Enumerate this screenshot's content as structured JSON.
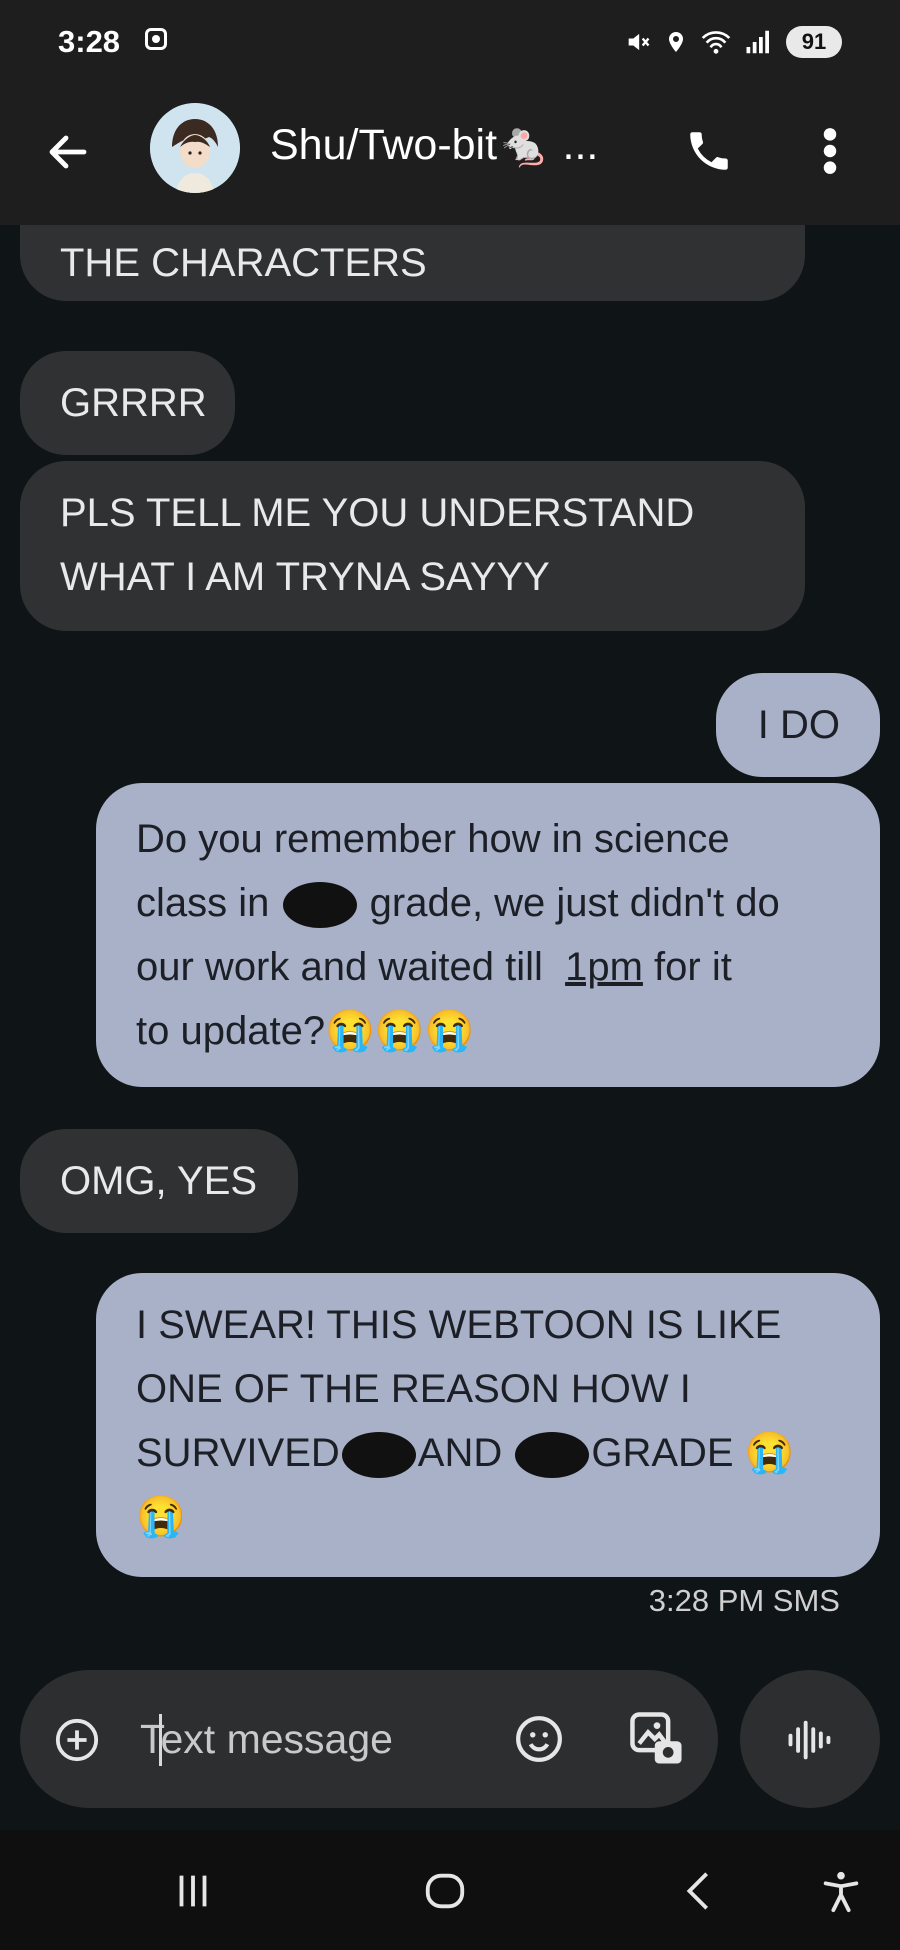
{
  "status_bar": {
    "time": "3:28",
    "battery": "91"
  },
  "header": {
    "contact_name": "Shu/Two-bit🐁 ..."
  },
  "messages": [
    {
      "dir": "in",
      "text": "PEOPLE ARE WEIRD ABT THE CHARACTERS"
    },
    {
      "dir": "in",
      "text": "GRRRR"
    },
    {
      "dir": "in",
      "lines": [
        "PLS TELL ME YOU UNDERSTAND",
        "WHAT I AM TRYNA SAYYY"
      ]
    },
    {
      "dir": "out",
      "text": "I DO"
    },
    {
      "dir": "out",
      "parts": [
        "Do you remember how in science",
        "class in",
        "grade, we just didn't do",
        "our work and waited till",
        "1pm",
        "for it",
        "to update?"
      ],
      "emoji": "😭😭😭"
    },
    {
      "dir": "in",
      "text": "OMG, YES"
    },
    {
      "dir": "out",
      "parts": [
        "I SWEAR! THIS WEBTOON IS LIKE",
        "ONE OF THE REASON HOW I",
        "SURVIVED",
        "AND",
        "GRADE"
      ],
      "emoji": "😭",
      "emoji2": "😭"
    }
  ],
  "timestamp": "3:28 PM SMS",
  "composer": {
    "placeholder": "Text message"
  },
  "icons": [
    "back-arrow-icon",
    "phone-icon",
    "more-vert-icon",
    "add-circle-icon",
    "emoji-icon",
    "gallery-icon",
    "voice-icon",
    "recents-icon",
    "home-icon",
    "nav-back-icon",
    "accessibility-icon"
  ]
}
